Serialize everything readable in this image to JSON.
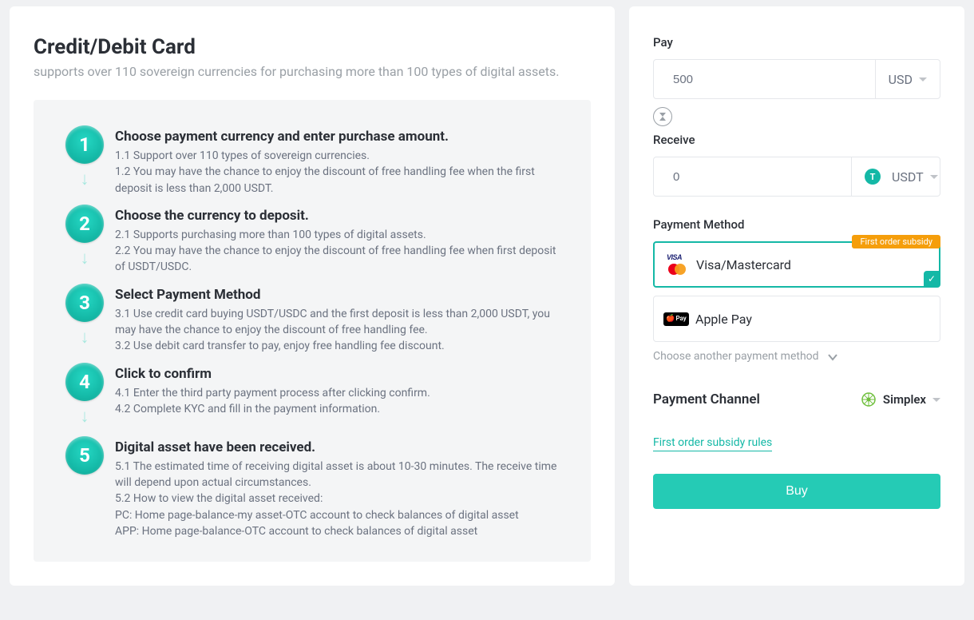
{
  "page": {
    "title": "Credit/Debit Card",
    "subtitle": "supports over 110 sovereign currencies for purchasing more than 100 types of digital assets."
  },
  "steps": [
    {
      "num": "1",
      "title": "Choose payment currency and enter purchase amount.",
      "text": "1.1 Support over 110 types of sovereign currencies.\n1.2 You may have the chance to enjoy the discount of free handling fee when the first deposit is less than 2,000 USDT."
    },
    {
      "num": "2",
      "title": "Choose the currency to deposit.",
      "text": "2.1 Supports purchasing more than 100 types of digital assets.\n2.2 You may have the chance to enjoy the discount of free handling fee when first deposit of USDT/USDC."
    },
    {
      "num": "3",
      "title": "Select Payment Method",
      "text": "3.1 Use credit card buying USDT/USDC and the first deposit is less than 2,000 USDT, you may have the chance to enjoy the discount of free handling fee.\n3.2 Use debit card transfer to pay, enjoy free handling fee discount."
    },
    {
      "num": "4",
      "title": "Click to confirm",
      "text": "4.1 Enter the third party payment process after clicking confirm.\n4.2 Complete KYC and fill in the payment information."
    },
    {
      "num": "5",
      "title": "Digital asset have been received.",
      "text": "5.1 The estimated time of receiving digital asset is about 10-30 minutes. The receive time will depend upon actual circumstances.\n5.2 How to view the digital asset received:\nPC: Home page-balance-my asset-OTC account to check balances of digital asset\nAPP: Home page-balance-OTC account to check balances of digital asset"
    }
  ],
  "form": {
    "pay_label": "Pay",
    "pay_value": "500",
    "pay_currency": "USD",
    "receive_label": "Receive",
    "receive_value": "0",
    "receive_currency": "USDT",
    "payment_method_label": "Payment Method",
    "pm_visa_label": "Visa/Mastercard",
    "pm_visa_badge": "First order subsidy",
    "pm_apple_label": "Apple Pay",
    "choose_another": "Choose another payment method",
    "channel_label": "Payment Channel",
    "channel_value": "Simplex",
    "subsidy_link": "First order subsidy rules",
    "buy_label": "Buy"
  }
}
